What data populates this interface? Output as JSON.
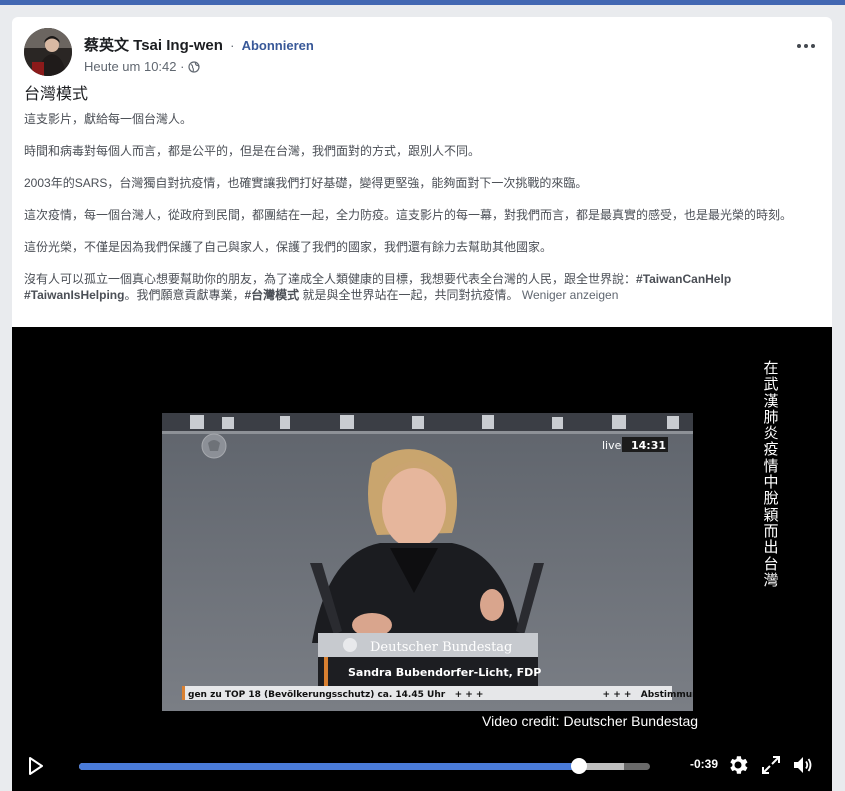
{
  "post": {
    "author": "蔡英文 Tsai Ing-wen",
    "separator": "·",
    "follow_label": "Abonnieren",
    "timestamp": "Heute um 10:42 ·",
    "privacy_icon": "globe-icon",
    "more_icon": "more-options-icon",
    "title": "台灣模式",
    "paragraphs": [
      "這支影片，獻給每一個台灣人。",
      "時間和病毒對每個人而言，都是公平的，但是在台灣，我們面對的方式，跟別人不同。",
      "2003年的SARS，台灣獨自對抗疫情，也確實讓我們打好基礎，變得更堅強，能夠面對下一次挑戰的來臨。",
      "這次疫情，每一個台灣人，從政府到民間，都團結在一起，全力防疫。這支影片的每一幕，對我們而言，都是最真實的感受，也是最光榮的時刻。",
      "這份光榮，不僅是因為我們保護了自己與家人，保護了我們的國家，我們還有餘力去幫助其他國家。"
    ],
    "last_paragraph": {
      "text_1": "沒有人可以孤立一個真心想要幫助你的朋友，為了達成全人類健康的目標，我想要代表全台灣的人民，跟全世界說：",
      "tag_1": "#TaiwanCanHelp",
      "tag_2": "#TaiwanIsHelping",
      "text_2": "。我們願意貢獻專業，",
      "tag_3": "#台灣模式",
      "text_3": " 就是與全世界站在一起，共同對抗疫情。",
      "see_less": "Weniger anzeigen"
    }
  },
  "video": {
    "vertical_caption": "在武漢肺炎疫情中脫穎而出 台灣",
    "frame": {
      "live_label": "live",
      "clock": "14:31",
      "podium_label": "Deutscher Bundestag",
      "speaker_name": "Sandra Bubendorfer-Licht, FDP",
      "ticker": "gen zu TOP 18 (Bevölkerungsschutz) ca. 14.45 Uhr   + + +                                      + + +   Abstimmungen"
    },
    "credit": "Video credit: Deutscher Bundestag",
    "controls": {
      "time_remaining": "-0:39",
      "progress_fraction": 0.876,
      "buffered_fraction": 0.955,
      "icons": [
        "play-icon",
        "settings-gear-icon",
        "fullscreen-icon",
        "volume-icon"
      ]
    }
  },
  "colors": {
    "link_blue": "#385898",
    "progress_blue": "#4a7bd8",
    "page_bg": "#e9ebee",
    "facebook_blue": "#4267b2"
  }
}
